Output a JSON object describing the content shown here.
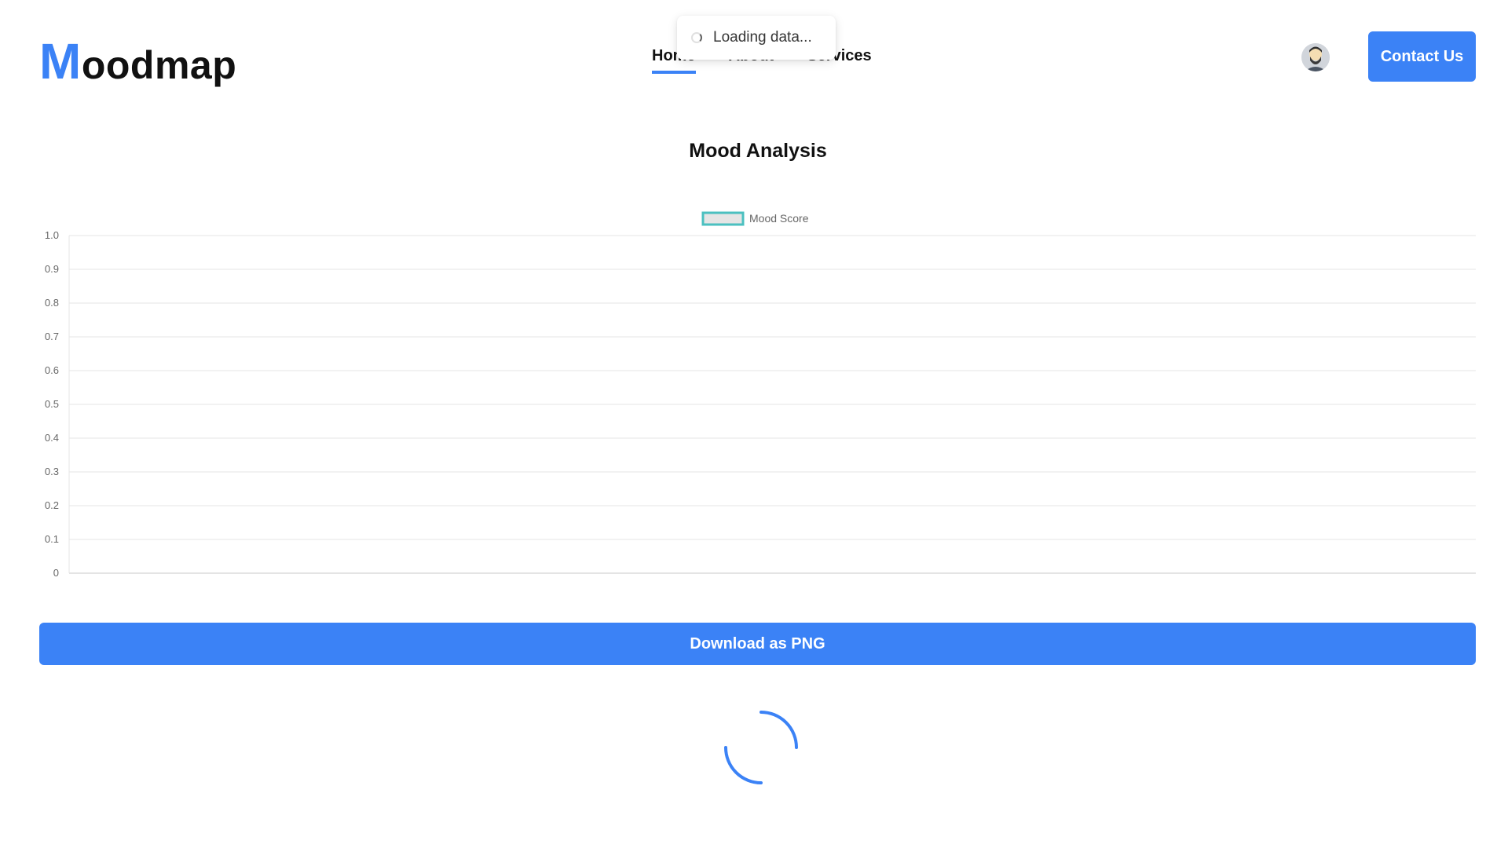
{
  "header": {
    "logo_initial": "M",
    "logo_rest": "oodmap",
    "nav": [
      {
        "label": "Home",
        "active": true
      },
      {
        "label": "About",
        "active": false
      },
      {
        "label": "Services",
        "active": false
      }
    ],
    "contact_label": "Contact Us"
  },
  "toast": {
    "text": "Loading data..."
  },
  "page_title": "Mood Analysis",
  "download_label": "Download as PNG",
  "colors": {
    "accent": "#3b82f6",
    "series_border": "#4bc0c0",
    "series_fill": "#e5e5e5"
  },
  "chart_data": {
    "type": "line",
    "series": [
      {
        "name": "Mood Score",
        "values": []
      }
    ],
    "categories": [],
    "ylim": [
      0,
      1
    ],
    "yticks": [
      "0",
      "0.1",
      "0.2",
      "0.3",
      "0.4",
      "0.5",
      "0.6",
      "0.7",
      "0.8",
      "0.9",
      "1.0"
    ],
    "grid": true,
    "legend": "top"
  }
}
